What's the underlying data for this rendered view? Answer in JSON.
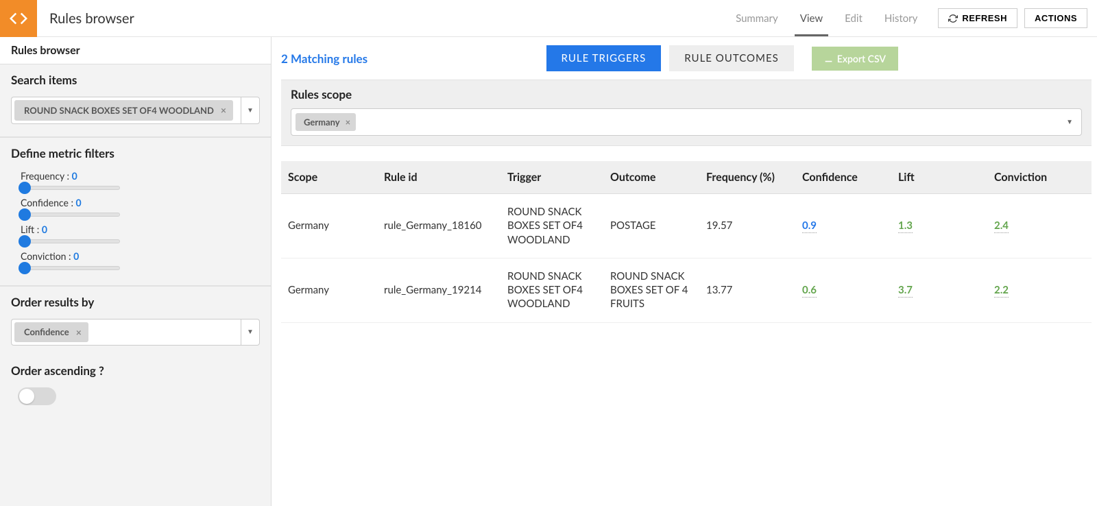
{
  "header": {
    "page_title": "Rules browser",
    "tabs": [
      "Summary",
      "View",
      "Edit",
      "History"
    ],
    "active_tab": "View",
    "refresh_label": "REFRESH",
    "actions_label": "ACTIONS"
  },
  "sidebar": {
    "tab_label": "Rules browser",
    "search_heading": "Search items",
    "search_chip": "ROUND SNACK BOXES SET OF4 WOODLAND",
    "filters_heading": "Define metric filters",
    "sliders": {
      "frequency": {
        "label": "Frequency :",
        "value": "0"
      },
      "confidence": {
        "label": "Confidence :",
        "value": "0"
      },
      "lift": {
        "label": "Lift :",
        "value": "0"
      },
      "conviction": {
        "label": "Conviction :",
        "value": "0"
      }
    },
    "order_heading": "Order results by",
    "order_chip": "Confidence",
    "ascending_heading": "Order ascending ?"
  },
  "main": {
    "matching_label": "2 Matching rules",
    "tab_triggers": "RULE TRIGGERS",
    "tab_outcomes": "RULE OUTCOMES",
    "export_label": "Export CSV",
    "scope_title": "Rules scope",
    "scope_chip": "Germany",
    "columns": {
      "scope": "Scope",
      "rule_id": "Rule id",
      "trigger": "Trigger",
      "outcome": "Outcome",
      "frequency": "Frequency (%)",
      "confidence": "Confidence",
      "lift": "Lift",
      "conviction": "Conviction"
    },
    "rows": [
      {
        "scope": "Germany",
        "rule_id": "rule_Germany_18160",
        "trigger": "ROUND SNACK BOXES SET OF4 WOODLAND",
        "outcome": "POSTAGE",
        "frequency": "19.57",
        "confidence": "0.9",
        "conf_color": "blue",
        "lift": "1.3",
        "conviction": "2.4"
      },
      {
        "scope": "Germany",
        "rule_id": "rule_Germany_19214",
        "trigger": "ROUND SNACK BOXES SET OF4 WOODLAND",
        "outcome": "ROUND SNACK BOXES SET OF 4 FRUITS",
        "frequency": "13.77",
        "confidence": "0.6",
        "conf_color": "green",
        "lift": "3.7",
        "conviction": "2.2"
      }
    ]
  }
}
